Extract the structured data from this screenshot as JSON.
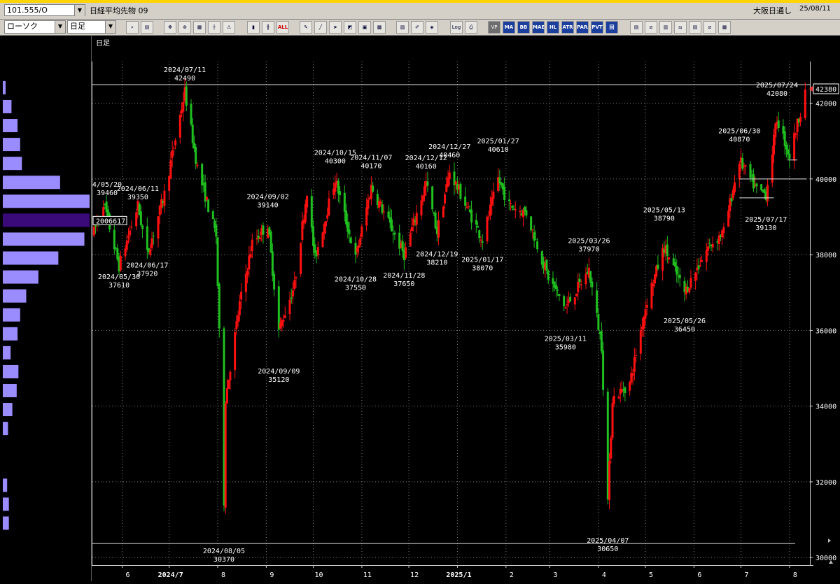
{
  "header": {
    "symbol_code": "101.555/O",
    "instrument_name": "日経平均先物 09",
    "session": "大阪日通し",
    "date": "25/08/11",
    "chart_style": "ローソク",
    "period": "日足"
  },
  "toolbar": {
    "tools": [
      "search-icon",
      "layout-icon",
      "pointer-icon",
      "zoom-icon",
      "grid-icon",
      "warning-icon",
      "bar-icon",
      "candle-icon",
      "all-icon",
      "pen-icon",
      "line-icon",
      "cursor-icon",
      "shape-icon",
      "text-icon",
      "delete-icon",
      "pattern-icon",
      "brush-icon",
      "color-icon",
      "log-icon",
      "print-icon"
    ],
    "labels": {
      "all": "ALL",
      "log": "Log",
      "vp": "VP",
      "ma": "MA",
      "bb": "BB",
      "mae": "MAE",
      "hl": "HL",
      "atr": "ATR",
      "para": "PARA",
      "pvt": "PVT",
      "ichimoku": "回"
    }
  },
  "chart_data": {
    "type": "candlestick",
    "period_label": "日足",
    "ylim": [
      29800,
      43100
    ],
    "yticks": [
      30000,
      32000,
      34000,
      36000,
      38000,
      40000,
      42000
    ],
    "xtick_labels": [
      "6",
      "2024/7",
      "8",
      "9",
      "10",
      "11",
      "12",
      "2025/1",
      "2",
      "3",
      "4",
      "5",
      "6",
      "7",
      "8"
    ],
    "last_price": "42380",
    "volume_profile_label": "2006617",
    "annotations": [
      {
        "date": "2024/07/11",
        "value": "42490",
        "pos": "above"
      },
      {
        "date": "4/05/20",
        "value": "39460",
        "pos": "above"
      },
      {
        "date": "2024/06/11",
        "value": "39350",
        "pos": "above"
      },
      {
        "date": "2024/05/30",
        "value": "37610",
        "pos": "below"
      },
      {
        "date": "2024/06/17",
        "value": "37920",
        "pos": "below"
      },
      {
        "date": "2024/08/05",
        "value": "30370",
        "pos": "below"
      },
      {
        "date": "2024/09/02",
        "value": "39140",
        "pos": "above"
      },
      {
        "date": "2024/09/09",
        "value": "35120",
        "pos": "below"
      },
      {
        "date": "2024/10/15",
        "value": "40300",
        "pos": "above"
      },
      {
        "date": "2024/11/07",
        "value": "40170",
        "pos": "above"
      },
      {
        "date": "2024/12/12",
        "value": "40160",
        "pos": "above"
      },
      {
        "date": "2024/12/27",
        "value": "40460",
        "pos": "above"
      },
      {
        "date": "2025/01/27",
        "value": "40610",
        "pos": "above"
      },
      {
        "date": "2024/10/28",
        "value": "37550",
        "pos": "below"
      },
      {
        "date": "2024/11/28",
        "value": "37650",
        "pos": "below"
      },
      {
        "date": "2024/12/19",
        "value": "38210",
        "pos": "below"
      },
      {
        "date": "2025/01/17",
        "value": "38070",
        "pos": "below"
      },
      {
        "date": "2025/03/26",
        "value": "37970",
        "pos": "above"
      },
      {
        "date": "2025/03/11",
        "value": "35980",
        "pos": "below"
      },
      {
        "date": "2025/04/07",
        "value": "30650",
        "pos": "below"
      },
      {
        "date": "2025/05/13",
        "value": "38790",
        "pos": "above"
      },
      {
        "date": "2025/05/26",
        "value": "36450",
        "pos": "below"
      },
      {
        "date": "2025/06/30",
        "value": "40870",
        "pos": "above"
      },
      {
        "date": "2025/07/17",
        "value": "39130",
        "pos": "below"
      },
      {
        "date": "2025/07/24",
        "value": "42080",
        "pos": "above"
      }
    ],
    "anchors": [
      {
        "d": "2024/05/14",
        "v": 38600
      },
      {
        "d": "2024/05/20",
        "v": 39400
      },
      {
        "d": "2024/05/30",
        "v": 37700
      },
      {
        "d": "2024/06/11",
        "v": 39300
      },
      {
        "d": "2024/06/17",
        "v": 38000
      },
      {
        "d": "2024/06/28",
        "v": 39600
      },
      {
        "d": "2024/07/11",
        "v": 42300
      },
      {
        "d": "2024/07/19",
        "v": 40300
      },
      {
        "d": "2024/07/31",
        "v": 38500
      },
      {
        "d": "2024/08/02",
        "v": 35900
      },
      {
        "d": "2024/08/05",
        "v": 31500
      },
      {
        "d": "2024/08/06",
        "v": 34200
      },
      {
        "d": "2024/08/15",
        "v": 36700
      },
      {
        "d": "2024/08/23",
        "v": 38300
      },
      {
        "d": "2024/09/02",
        "v": 38800
      },
      {
        "d": "2024/09/09",
        "v": 36000
      },
      {
        "d": "2024/09/19",
        "v": 37200
      },
      {
        "d": "2024/09/27",
        "v": 39700
      },
      {
        "d": "2024/10/02",
        "v": 37900
      },
      {
        "d": "2024/10/15",
        "v": 40000
      },
      {
        "d": "2024/10/28",
        "v": 37900
      },
      {
        "d": "2024/11/07",
        "v": 39800
      },
      {
        "d": "2024/11/28",
        "v": 38000
      },
      {
        "d": "2024/12/12",
        "v": 39900
      },
      {
        "d": "2024/12/19",
        "v": 38600
      },
      {
        "d": "2024/12/27",
        "v": 40200
      },
      {
        "d": "2025/01/17",
        "v": 38400
      },
      {
        "d": "2025/01/27",
        "v": 40000
      },
      {
        "d": "2025/02/03",
        "v": 39300
      },
      {
        "d": "2025/02/14",
        "v": 39100
      },
      {
        "d": "2025/02/28",
        "v": 37400
      },
      {
        "d": "2025/03/11",
        "v": 36600
      },
      {
        "d": "2025/03/26",
        "v": 37600
      },
      {
        "d": "2025/04/03",
        "v": 35600
      },
      {
        "d": "2025/04/07",
        "v": 31500
      },
      {
        "d": "2025/04/10",
        "v": 34200
      },
      {
        "d": "2025/04/21",
        "v": 34600
      },
      {
        "d": "2025/05/02",
        "v": 36800
      },
      {
        "d": "2025/05/13",
        "v": 38200
      },
      {
        "d": "2025/05/26",
        "v": 37000
      },
      {
        "d": "2025/06/10",
        "v": 38200
      },
      {
        "d": "2025/06/20",
        "v": 38600
      },
      {
        "d": "2025/06/30",
        "v": 40500
      },
      {
        "d": "2025/07/11",
        "v": 39700
      },
      {
        "d": "2025/07/17",
        "v": 39600
      },
      {
        "d": "2025/07/24",
        "v": 41600
      },
      {
        "d": "2025/08/01",
        "v": 40600
      },
      {
        "d": "2025/08/08",
        "v": 41800
      },
      {
        "d": "2025/08/11",
        "v": 42380
      }
    ]
  },
  "volume_profile": {
    "bins": [
      {
        "price": 42400,
        "vol": 0.03
      },
      {
        "price": 41900,
        "vol": 0.1
      },
      {
        "price": 41400,
        "vol": 0.17
      },
      {
        "price": 40900,
        "vol": 0.2
      },
      {
        "price": 40400,
        "vol": 0.22
      },
      {
        "price": 39900,
        "vol": 0.66
      },
      {
        "price": 39400,
        "vol": 1.0
      },
      {
        "price": 38900,
        "vol": 1.0,
        "poc": true
      },
      {
        "price": 38400,
        "vol": 0.94
      },
      {
        "price": 37900,
        "vol": 0.64
      },
      {
        "price": 37400,
        "vol": 0.41
      },
      {
        "price": 36900,
        "vol": 0.27
      },
      {
        "price": 36400,
        "vol": 0.2
      },
      {
        "price": 35900,
        "vol": 0.17
      },
      {
        "price": 35400,
        "vol": 0.09
      },
      {
        "price": 34900,
        "vol": 0.18
      },
      {
        "price": 34400,
        "vol": 0.16
      },
      {
        "price": 33900,
        "vol": 0.11
      },
      {
        "price": 33400,
        "vol": 0.06
      },
      {
        "price": 31900,
        "vol": 0.05
      },
      {
        "price": 31400,
        "vol": 0.07
      },
      {
        "price": 30900,
        "vol": 0.07
      }
    ]
  },
  "colors": {
    "up": "#ff1010",
    "down": "#20c020",
    "vp": "#9a8cff",
    "vp_poc": "#3a0a7a"
  }
}
